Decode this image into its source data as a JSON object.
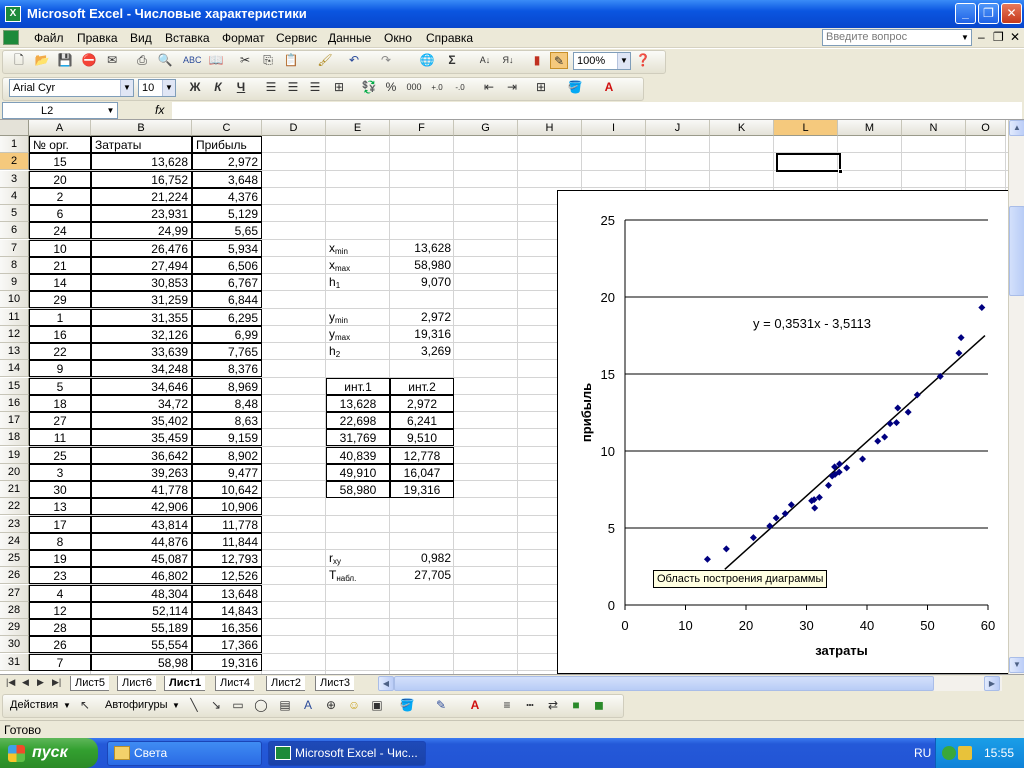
{
  "window": {
    "title": "Microsoft Excel - Числовые характеристики"
  },
  "menu": {
    "items": [
      "Файл",
      "Правка",
      "Вид",
      "Вставка",
      "Формат",
      "Сервис",
      "Данные",
      "Окно",
      "Справка"
    ],
    "ask_placeholder": "Введите вопрос"
  },
  "toolbar": {
    "zoom": "100%",
    "font": "Arial Cyr",
    "font_size": "10",
    "bold": "Ж",
    "italic": "К",
    "underline": "Ч",
    "percent": "%",
    "thousands": "000"
  },
  "formula": {
    "name_box": "L2",
    "fx": "fx",
    "value": ""
  },
  "columns": [
    "A",
    "B",
    "C",
    "D",
    "E",
    "F",
    "G",
    "H",
    "I",
    "J",
    "K",
    "L",
    "M",
    "N",
    "O"
  ],
  "selected_column": "L",
  "rows": [
    "1",
    "2",
    "3",
    "4",
    "5",
    "6",
    "7",
    "8",
    "9",
    "10",
    "11",
    "12",
    "13",
    "14",
    "15",
    "16",
    "17",
    "18",
    "19",
    "20",
    "21",
    "22",
    "23",
    "24",
    "25",
    "26",
    "27",
    "28",
    "29",
    "30",
    "31"
  ],
  "headers": {
    "a": "№ орг.",
    "b": "Затраты",
    "c": "Прибыль"
  },
  "table": [
    [
      "15",
      "13,628",
      "2,972"
    ],
    [
      "20",
      "16,752",
      "3,648"
    ],
    [
      "2",
      "21,224",
      "4,376"
    ],
    [
      "6",
      "23,931",
      "5,129"
    ],
    [
      "24",
      "24,99",
      "5,65"
    ],
    [
      "10",
      "26,476",
      "5,934"
    ],
    [
      "21",
      "27,494",
      "6,506"
    ],
    [
      "14",
      "30,853",
      "6,767"
    ],
    [
      "29",
      "31,259",
      "6,844"
    ],
    [
      "1",
      "31,355",
      "6,295"
    ],
    [
      "16",
      "32,126",
      "6,99"
    ],
    [
      "22",
      "33,639",
      "7,765"
    ],
    [
      "9",
      "34,248",
      "8,376"
    ],
    [
      "5",
      "34,646",
      "8,969"
    ],
    [
      "18",
      "34,72",
      "8,48"
    ],
    [
      "27",
      "35,402",
      "8,63"
    ],
    [
      "11",
      "35,459",
      "9,159"
    ],
    [
      "25",
      "36,642",
      "8,902"
    ],
    [
      "3",
      "39,263",
      "9,477"
    ],
    [
      "30",
      "41,778",
      "10,642"
    ],
    [
      "13",
      "42,906",
      "10,906"
    ],
    [
      "17",
      "43,814",
      "11,778"
    ],
    [
      "8",
      "44,876",
      "11,844"
    ],
    [
      "19",
      "45,087",
      "12,793"
    ],
    [
      "23",
      "46,802",
      "12,526"
    ],
    [
      "4",
      "48,304",
      "13,648"
    ],
    [
      "12",
      "52,114",
      "14,843"
    ],
    [
      "28",
      "55,189",
      "16,356"
    ],
    [
      "26",
      "55,554",
      "17,366"
    ],
    [
      "7",
      "58,98",
      "19,316"
    ]
  ],
  "stats": {
    "xmin_label": "x",
    "xmin_sub": "min",
    "xmin": "13,628",
    "xmax_label": "x",
    "xmax_sub": "max",
    "xmax": "58,980",
    "h1_label": "h",
    "h1_sub": "1",
    "h1": "9,070",
    "ymin_label": "y",
    "ymin_sub": "min",
    "ymin": "2,972",
    "ymax_label": "y",
    "ymax_sub": "max",
    "ymax": "19,316",
    "h2_label": "h",
    "h2_sub": "2",
    "h2": "3,269",
    "rxy_label": "r",
    "rxy_sub": "xy",
    "rxy": "0,982",
    "t_label": "T",
    "t_sub": "набл.",
    "t": "27,705"
  },
  "intervals": {
    "h1": "инт.1",
    "h2": "инт.2",
    "rows": [
      [
        "13,628",
        "2,972"
      ],
      [
        "22,698",
        "6,241"
      ],
      [
        "31,769",
        "9,510"
      ],
      [
        "40,839",
        "12,778"
      ],
      [
        "49,910",
        "16,047"
      ],
      [
        "58,980",
        "19,316"
      ]
    ]
  },
  "chart_data": {
    "type": "scatter",
    "xlabel": "затраты",
    "ylabel": "прибыль",
    "xlim": [
      0,
      60
    ],
    "ylim": [
      0,
      25
    ],
    "xticks": [
      "0",
      "10",
      "20",
      "30",
      "40",
      "50",
      "60"
    ],
    "yticks": [
      "0",
      "5",
      "10",
      "15",
      "20",
      "25"
    ],
    "grid": "horizontal",
    "equation": "y = 0,3531x - 3,5113",
    "trendline": {
      "slope": 0.3531,
      "intercept": -3.5113,
      "x_range": [
        16.5,
        59.5
      ]
    },
    "series": [
      {
        "x": [
          13.628,
          16.752,
          21.224,
          23.931,
          24.99,
          26.476,
          27.494,
          30.853,
          31.259,
          31.355,
          32.126,
          33.639,
          34.248,
          34.646,
          34.72,
          35.402,
          35.459,
          36.642,
          39.263,
          41.778,
          42.906,
          43.814,
          44.876,
          45.087,
          46.802,
          48.304,
          52.114,
          55.189,
          55.554,
          58.98
        ],
        "y": [
          2.972,
          3.648,
          4.376,
          5.129,
          5.65,
          5.934,
          6.506,
          6.767,
          6.844,
          6.295,
          6.99,
          7.765,
          8.376,
          8.969,
          8.48,
          8.63,
          9.159,
          8.902,
          9.477,
          10.642,
          10.906,
          11.778,
          11.844,
          12.793,
          12.526,
          13.648,
          14.843,
          16.356,
          17.366,
          19.316
        ]
      }
    ],
    "tooltip": "Область построения диаграммы"
  },
  "sheets": {
    "tabs": [
      "Лист5",
      "Лист6",
      "Лист1",
      "Лист4",
      "Лист2",
      "Лист3"
    ],
    "active": "Лист1"
  },
  "drawing": {
    "actions": "Действия",
    "autoshapes": "Автофигуры"
  },
  "status": {
    "text": "Готово"
  },
  "taskbar": {
    "start": "пуск",
    "tasks": [
      "Света",
      "Microsoft Excel - Чис..."
    ],
    "lang": "RU",
    "time": "15:55"
  }
}
